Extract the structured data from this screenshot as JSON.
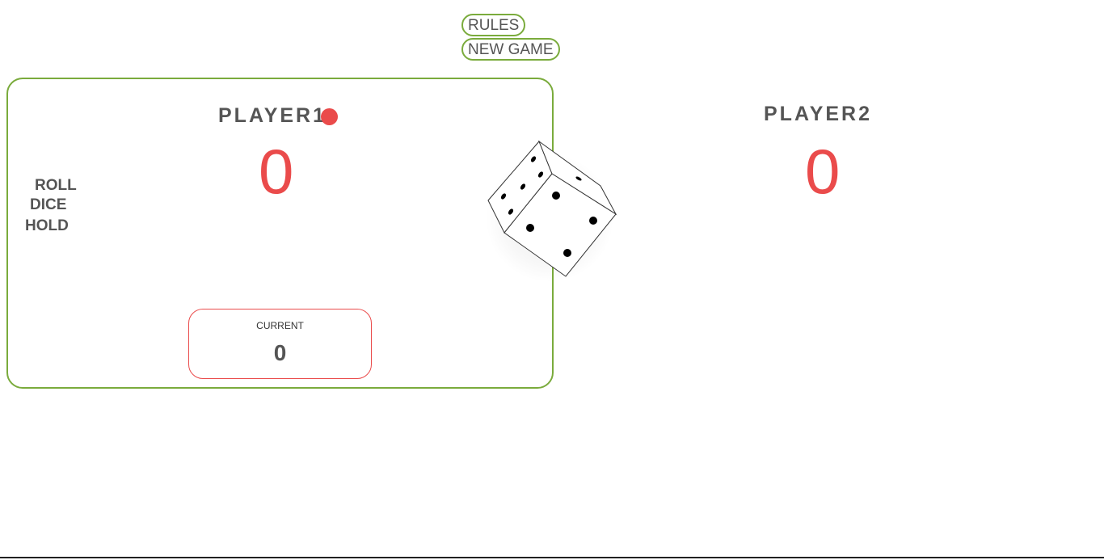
{
  "header": {
    "rules_label": "RULES",
    "new_game_label": "NEW GAME"
  },
  "player1": {
    "name": "PLAYER1",
    "score": "0",
    "active": true,
    "current_label": "CURRENT",
    "current_value": "0"
  },
  "player2": {
    "name": "PLAYER2",
    "score": "0"
  },
  "controls": {
    "roll_label": "ROLL",
    "dice_label": "DICE",
    "hold_label": "HOLD"
  },
  "dice": {
    "icon": "dice-icon"
  },
  "colors": {
    "accent_green": "#7aab3c",
    "accent_red": "#ea4b4b",
    "text": "#555555"
  }
}
